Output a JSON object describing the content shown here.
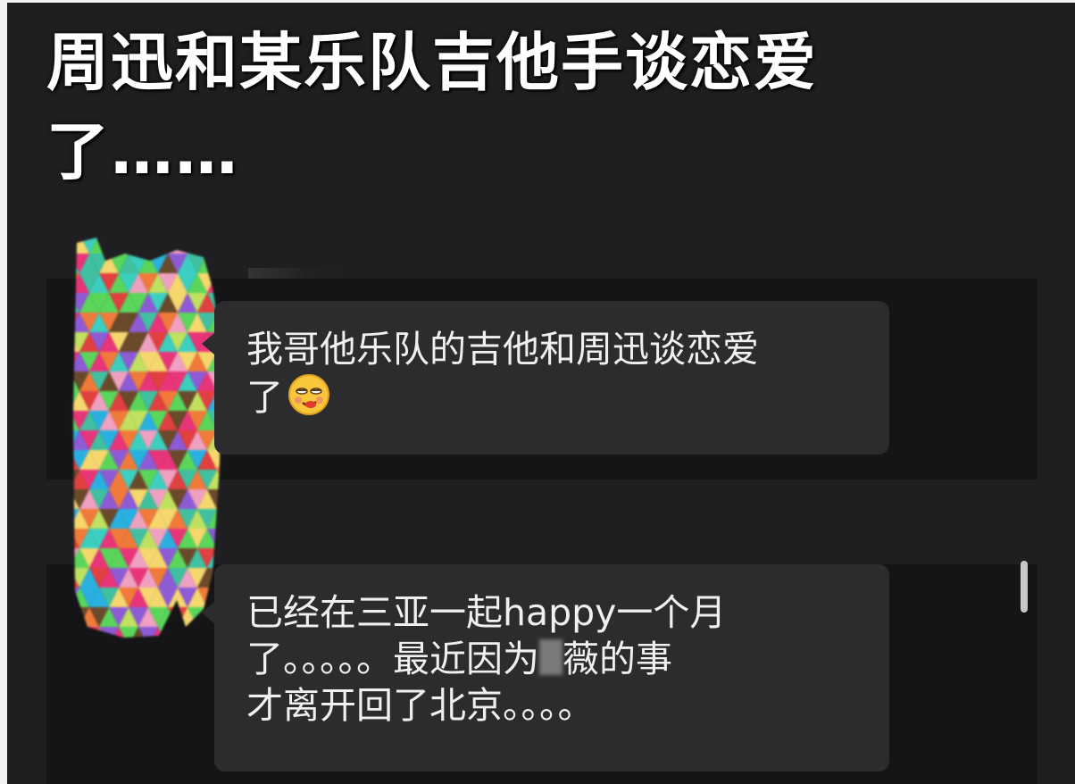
{
  "headline": {
    "line1": "周迅和某乐队吉他手谈恋爱",
    "line2": "了……"
  },
  "messages": [
    {
      "line1": "我哥他乐队的吉他和周迅谈恋爱",
      "line2": "了",
      "emoji": "smirk-emoji"
    },
    {
      "line1": "已经在三亚一起happy一个月",
      "line2_before": "了。。。。。最近因为",
      "line2_after": "薇的事",
      "line3": "才离开回了北京。。。。"
    }
  ],
  "avatar": {
    "icon": "mosaic-censored-avatar"
  },
  "colors": {
    "background": "#1f1f21",
    "bubble": "#2c2c2e",
    "text": "#f0f0f0"
  }
}
